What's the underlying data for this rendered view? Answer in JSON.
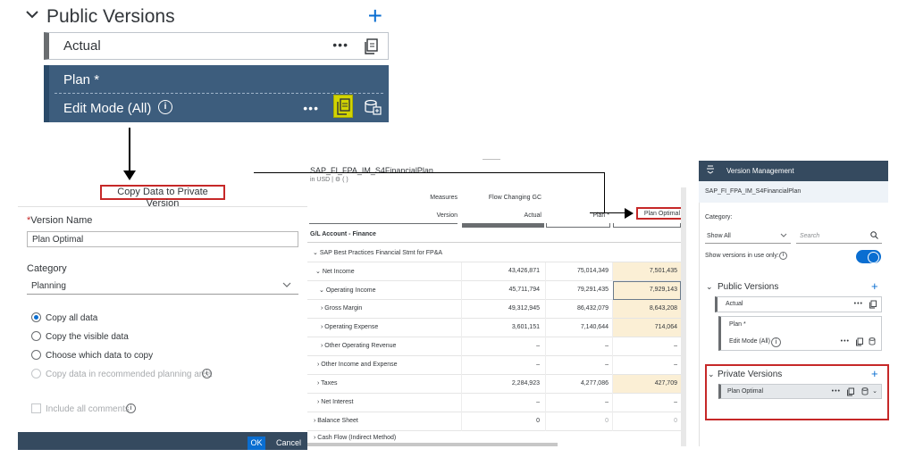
{
  "zoom_panel": {
    "section_title": "Public Versions",
    "actual_label": "Actual",
    "plan_label": "Plan *",
    "edit_mode_label": "Edit Mode (All)",
    "more_glyph": "•••",
    "info_glyph": "i",
    "plus_glyph": "+",
    "chevron_glyph": "⌄"
  },
  "dialog": {
    "title": "Copy Data to Private Version",
    "version_name_label": "Version Name",
    "required_marker": "*",
    "version_name_value": "Plan Optimal",
    "category_label": "Category",
    "category_value": "Planning",
    "options": [
      {
        "label": "Copy all data",
        "selected": true,
        "disabled": false
      },
      {
        "label": "Copy the visible data",
        "selected": false,
        "disabled": false
      },
      {
        "label": "Choose which data to copy",
        "selected": false,
        "disabled": false
      },
      {
        "label": "Copy data in recommended planning area",
        "selected": false,
        "disabled": true
      }
    ],
    "include_comments_label": "Include all comments",
    "ok_label": "OK",
    "cancel_label": "Cancel"
  },
  "table": {
    "title": "SAP_FI_FPA_IM_S4FinancialPlan",
    "subtitle": "in USD",
    "measures_label": "Measures",
    "measure_value": "Flow Changing GC",
    "version_label": "Version",
    "col_actual": "Actual",
    "col_plan": "Plan *",
    "col_plan_optimal": "Plan Optimal",
    "row_dim_label": "G/L Account - Finance",
    "rows": [
      {
        "name": "SAP Best Practices Financial Stmt for FP&A",
        "glyph": "⌄",
        "a": "",
        "p": "",
        "o": ""
      },
      {
        "name": "Net Income",
        "glyph": "⌄",
        "a": "43,426,871",
        "p": "75,014,349",
        "o": "7,501,435"
      },
      {
        "name": "Operating Income",
        "glyph": "⌄",
        "a": "45,711,794",
        "p": "79,291,435",
        "o": "7,929,143"
      },
      {
        "name": "Gross Margin",
        "glyph": "›",
        "a": "49,312,945",
        "p": "86,432,079",
        "o": "8,643,208"
      },
      {
        "name": "Operating Expense",
        "glyph": "›",
        "a": "3,601,151",
        "p": "7,140,644",
        "o": "714,064"
      },
      {
        "name": "Other Operating Revenue",
        "glyph": "›",
        "a": "–",
        "p": "–",
        "o": "–"
      },
      {
        "name": "Other Income and Expense",
        "glyph": "›",
        "a": "–",
        "p": "–",
        "o": "–"
      },
      {
        "name": "Taxes",
        "glyph": "›",
        "a": "2,284,923",
        "p": "4,277,086",
        "o": "427,709"
      },
      {
        "name": "Net Interest",
        "glyph": "›",
        "a": "–",
        "p": "–",
        "o": "–"
      },
      {
        "name": "Balance Sheet",
        "glyph": "›",
        "a": "0",
        "p": "0",
        "o": "0"
      },
      {
        "name": "Cash Flow (Indirect Method)",
        "glyph": "›",
        "a": "",
        "p": "",
        "o": ""
      }
    ]
  },
  "version_mgmt": {
    "title": "Version Management",
    "model": "SAP_FI_FPA_IM_S4FinancialPlan",
    "category_label": "Category:",
    "category_value": "Show All",
    "search_placeholder": "Search",
    "show_in_use_label": "Show versions in use only:",
    "public_title": "Public Versions",
    "actual_label": "Actual",
    "plan_label": "Plan *",
    "edit_mode_label": "Edit Mode (All)",
    "private_title": "Private Versions",
    "private_item": "Plan Optimal"
  },
  "colors": {
    "accent": "#0a6ed1",
    "plan_card_bg": "#3d5d7d",
    "highlight_red": "#c62828",
    "highlight_yellow": "#d2d400",
    "cell_highlight": "#fbefd5",
    "shell_bar": "#354a5f"
  }
}
